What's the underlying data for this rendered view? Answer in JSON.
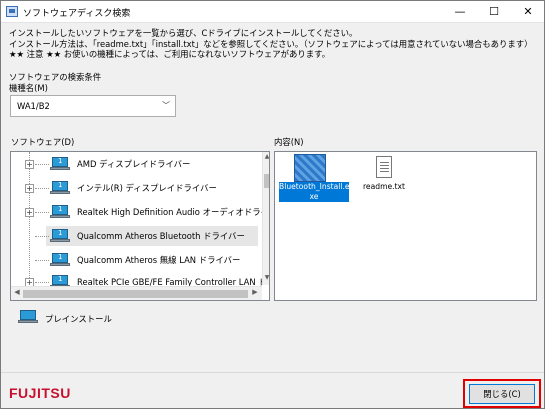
{
  "window": {
    "title": "ソフトウェアディスク検索",
    "controls": {
      "minimize": "—",
      "maximize": "☐",
      "close": "✕"
    }
  },
  "intro": {
    "line1": "インストールしたいソフトウェアを一覧から選び、Cドライブにインストールしてください。",
    "line2": "インストール方法は、「readme.txt」「install.txt」などを参照してください。（ソフトウェアによっては用意されていない場合もあります）",
    "line3": "★★ 注意 ★★ お使いの機種によっては、ご利用になれないソフトウェアがあります。"
  },
  "search": {
    "section_label": "ソフトウェアの検索条件",
    "model_label": "機種名(M)",
    "model_value": "WA1/B2"
  },
  "software": {
    "label": "ソフトウェア(D)",
    "items": [
      {
        "label": "AMD ディスプレイドライバー",
        "expandable": true
      },
      {
        "label": "インテル(R) ディスプレイドライバー",
        "expandable": true
      },
      {
        "label": "Realtek High Definition Audio オーディオドライバー",
        "expandable": true
      },
      {
        "label": "Qualcomm Atheros Bluetooth ドライバー",
        "expandable": false,
        "selected": true
      },
      {
        "label": "Qualcomm Atheros 無線 LAN ドライバー",
        "expandable": false
      },
      {
        "label": "Realtek PCIe GBE/FE Family Controller LAN ドライバー",
        "expandable": true
      }
    ]
  },
  "contents": {
    "label": "内容(N)",
    "files": [
      {
        "name": "Bluetooth_Install.exe",
        "name_line1": "Bluetooth_Install.e",
        "name_line2": "xe",
        "selected": true
      },
      {
        "name": "readme.txt",
        "selected": false
      }
    ]
  },
  "legend": {
    "preinstall_label": "プレインストール"
  },
  "footer": {
    "brand": "FUJITSU",
    "close_label": "閉じる(C)"
  },
  "colors": {
    "selection": "#0078d7",
    "brand_red": "#c8102e",
    "highlight": "#e00000"
  }
}
